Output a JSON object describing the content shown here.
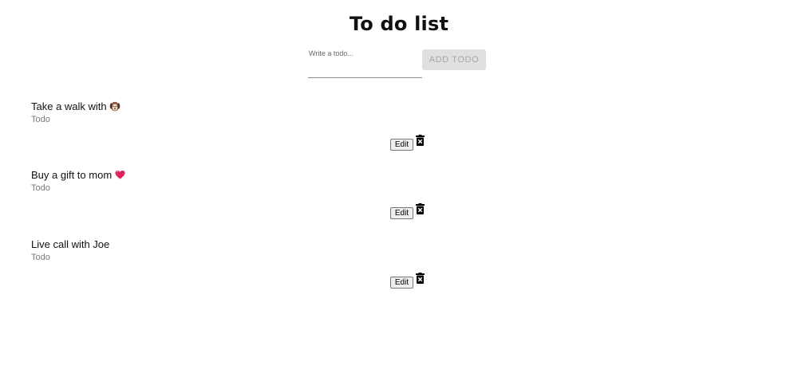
{
  "header": {
    "title": "To do list"
  },
  "form": {
    "input_placeholder": "Write a todo...",
    "input_value": "",
    "add_button_label": "ADD TODO"
  },
  "todos": [
    {
      "text": "Take a walk with",
      "emoji": "dog",
      "status": "Todo",
      "edit_label": "Edit",
      "delete_icon": "trash-icon"
    },
    {
      "text": "Buy a gift to mom",
      "emoji": "heart",
      "status": "Todo",
      "edit_label": "Edit",
      "delete_icon": "trash-icon"
    },
    {
      "text": "Live call with Joe",
      "emoji": "",
      "status": "Todo",
      "edit_label": "Edit",
      "delete_icon": "trash-icon"
    }
  ],
  "colors": {
    "add_button_bg": "#e0e0e0",
    "add_button_text": "#a6a6a6",
    "status_text": "#7a7a7a",
    "heart": "#e0245e"
  }
}
